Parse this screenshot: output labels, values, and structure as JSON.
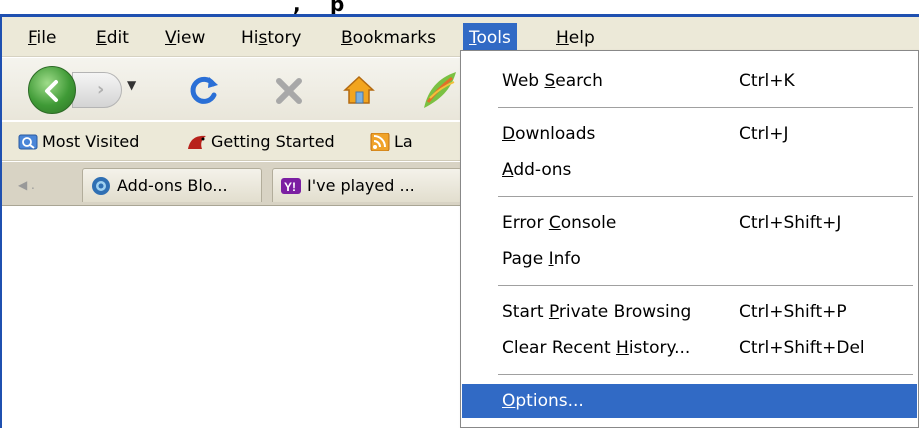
{
  "menubar": {
    "items": [
      {
        "pre": "",
        "key": "F",
        "post": "ile"
      },
      {
        "pre": "",
        "key": "E",
        "post": "dit"
      },
      {
        "pre": "",
        "key": "V",
        "post": "iew"
      },
      {
        "pre": "Hi",
        "key": "s",
        "post": "tory"
      },
      {
        "pre": "",
        "key": "B",
        "post": "ookmarks"
      },
      {
        "pre": "",
        "key": "T",
        "post": "ools"
      },
      {
        "pre": "",
        "key": "H",
        "post": "elp"
      }
    ],
    "active_index": 5
  },
  "bookmarks": [
    {
      "label": "Most Visited",
      "icon": "most-visited-icon"
    },
    {
      "label": "Getting Started",
      "icon": "getting-started-icon"
    },
    {
      "label": "La",
      "icon": "rss-feed-icon"
    }
  ],
  "tabs": [
    {
      "label": "Add-ons Blo...",
      "icon": "addons-blog-icon"
    },
    {
      "label": "I've played ...",
      "icon": "yahoo-icon"
    }
  ],
  "tools_menu": {
    "items": [
      {
        "pre": "Web ",
        "key": "S",
        "post": "earch",
        "shortcut": "Ctrl+K"
      },
      {
        "pre": "",
        "key": "D",
        "post": "ownloads",
        "shortcut": "Ctrl+J"
      },
      {
        "pre": "",
        "key": "A",
        "post": "dd-ons",
        "shortcut": ""
      },
      {
        "pre": "Error ",
        "key": "C",
        "post": "onsole",
        "shortcut": "Ctrl+Shift+J"
      },
      {
        "pre": "Page ",
        "key": "I",
        "post": "nfo",
        "shortcut": ""
      },
      {
        "pre": "Start ",
        "key": "P",
        "post": "rivate Browsing",
        "shortcut": "Ctrl+Shift+P"
      },
      {
        "pre": "Clear Recent ",
        "key": "H",
        "post": "istory...",
        "shortcut": "Ctrl+Shift+Del"
      },
      {
        "pre": "",
        "key": "O",
        "post": "ptions...",
        "shortcut": ""
      }
    ],
    "highlighted_index": 7
  },
  "colors": {
    "menu_highlight": "#316ac5",
    "menubar_bg": "#ece9d8",
    "window_border": "#1f50b0"
  }
}
